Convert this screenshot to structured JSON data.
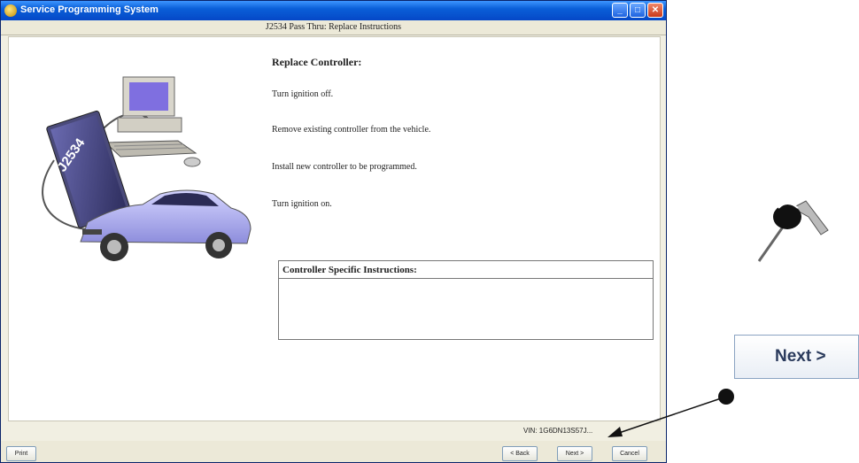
{
  "window": {
    "title": "Service Programming System",
    "subtitle": "J2534 Pass Thru:  Replace Instructions",
    "controls": {
      "minimize": "_",
      "maximize": "□",
      "close": "✕"
    }
  },
  "illustration": {
    "device_label": "J2534"
  },
  "instructions": {
    "heading": "Replace Controller:",
    "steps": [
      "Turn ignition off.",
      "Remove existing controller from the vehicle.",
      "Install new controller to be programmed.",
      "Turn ignition on."
    ]
  },
  "controller_specific": {
    "title": "Controller Specific Instructions:",
    "body": ""
  },
  "status": {
    "vin": "VIN: 1G6DN13S57J..."
  },
  "buttons": {
    "print": "Print",
    "back": "< Back",
    "next": "Next >",
    "cancel": "Cancel"
  },
  "callout": {
    "next_label": "Next >"
  },
  "colors": {
    "titlebar": "#0a5fd8",
    "dialog_bg": "#f1efe2",
    "car": "#b9b9f2"
  },
  "icons": [
    "app-icon",
    "minimize-icon",
    "maximize-icon",
    "close-icon",
    "ignition-key-icon",
    "pointer-arrow-icon"
  ]
}
